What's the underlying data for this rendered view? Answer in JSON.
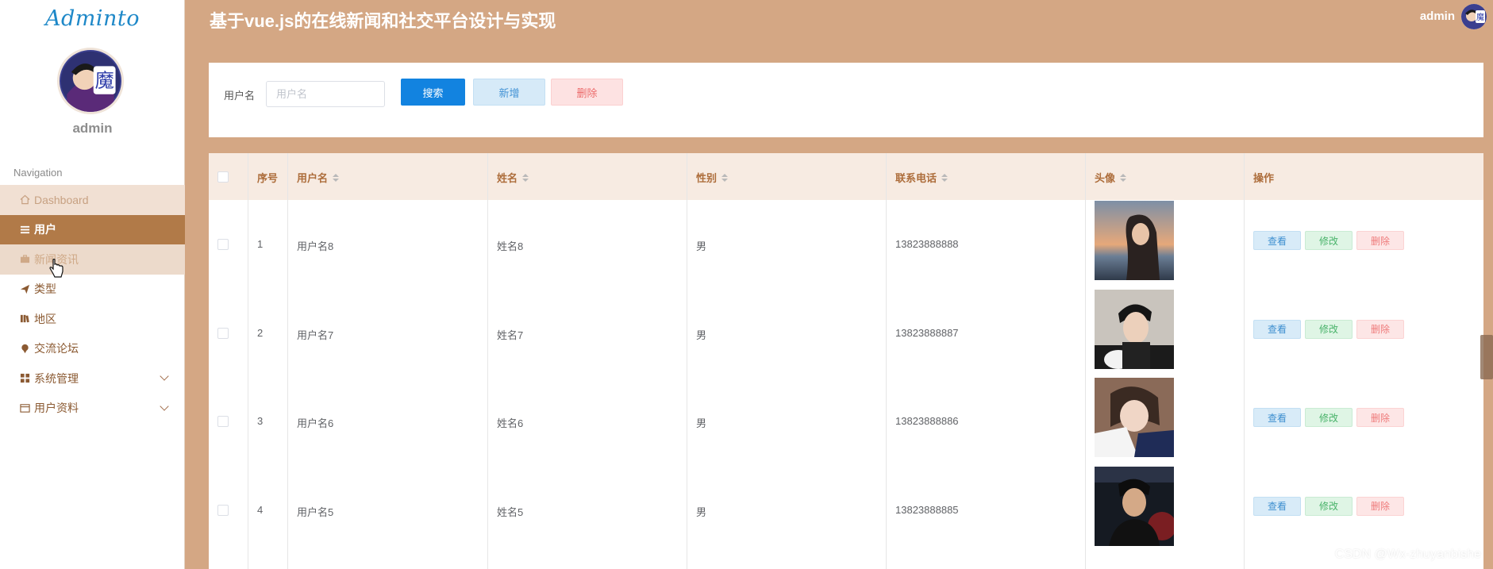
{
  "app": {
    "logo_text": "Adminto",
    "title": "基于vue.js的在线新闻和社交平台设计与实现",
    "user_name": "admin",
    "watermark": "CSDN @Wx-zhuyanbishe"
  },
  "sidebar": {
    "user_name": "admin",
    "nav_title": "Navigation",
    "items": [
      {
        "label": "Dashboard",
        "icon": "home-icon"
      },
      {
        "label": "用户",
        "icon": "list-icon"
      },
      {
        "label": "新闻资讯",
        "icon": "briefcase-icon"
      },
      {
        "label": "类型",
        "icon": "send-icon"
      },
      {
        "label": "地区",
        "icon": "book-icon"
      },
      {
        "label": "交流论坛",
        "icon": "pin-icon"
      },
      {
        "label": "系统管理",
        "icon": "grid-icon"
      },
      {
        "label": "用户资料",
        "icon": "card-icon"
      }
    ]
  },
  "search": {
    "label": "用户名",
    "placeholder": "用户名",
    "search_btn": "搜索",
    "add_btn": "新增",
    "delete_btn": "删除"
  },
  "table": {
    "headers": {
      "index": "序号",
      "username": "用户名",
      "name": "姓名",
      "gender": "性别",
      "phone": "联系电话",
      "avatar": "头像",
      "actions": "操作"
    },
    "actions": {
      "view": "查看",
      "edit": "修改",
      "delete": "删除"
    },
    "rows": [
      {
        "index": "1",
        "username": "用户名8",
        "name": "姓名8",
        "gender": "男",
        "phone": "13823888888"
      },
      {
        "index": "2",
        "username": "用户名7",
        "name": "姓名7",
        "gender": "男",
        "phone": "13823888887"
      },
      {
        "index": "3",
        "username": "用户名6",
        "name": "姓名6",
        "gender": "男",
        "phone": "13823888886"
      },
      {
        "index": "4",
        "username": "用户名5",
        "name": "姓名5",
        "gender": "男",
        "phone": "13823888885"
      }
    ]
  },
  "colors": {
    "brand": "#d4a784",
    "nav_active": "#b17a48",
    "primary": "#1283e0",
    "header_text": "#ad6d3b"
  }
}
